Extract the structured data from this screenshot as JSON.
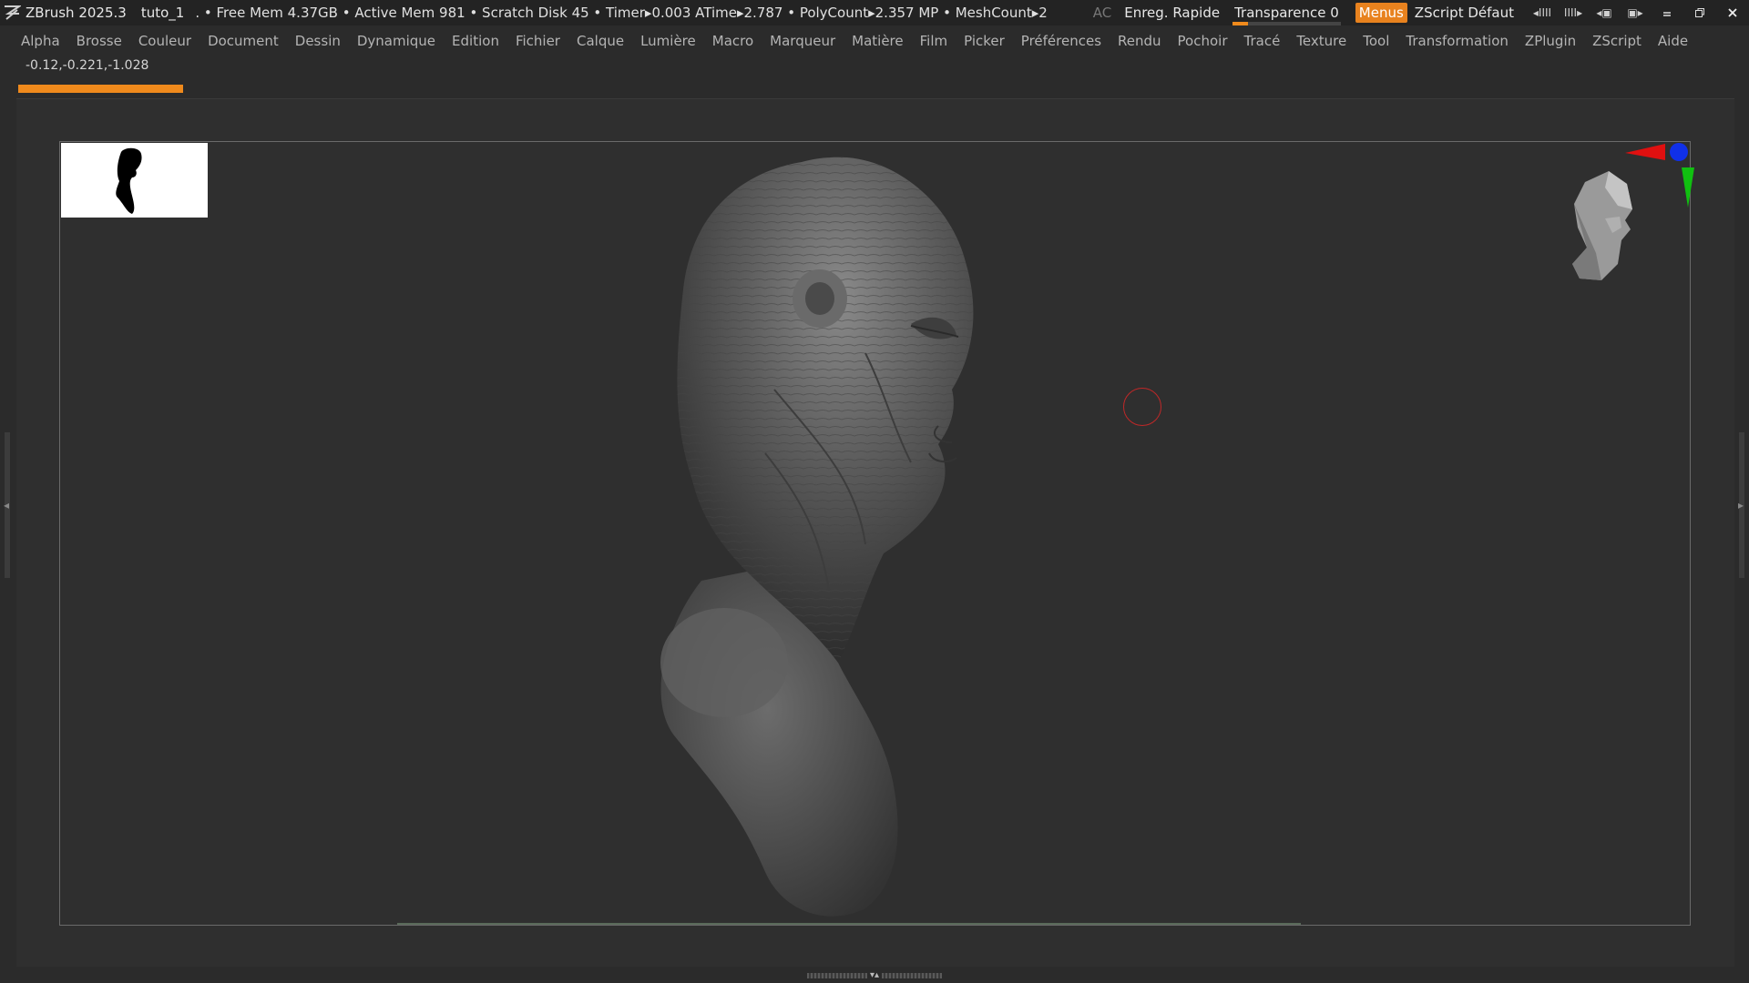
{
  "titlebar": {
    "app_title": "ZBrush 2025.3",
    "doc_name": "tuto_1",
    "stats": ". • Free Mem 4.37GB • Active Mem 981 • Scratch Disk 45 • Timer▸0.003 ATime▸2.787 • PolyCount▸2.357 MP • MeshCount▸2",
    "ac_label": "AC",
    "quicksave_label": "Enreg. Rapide",
    "transparency_label": "Transparence 0",
    "transparency_value": 0,
    "menus_button": "Menus",
    "zscript_default": "ZScript Défaut",
    "icons": [
      "palette-left-icon",
      "palette-right-icon",
      "layout-prev-icon",
      "layout-next-icon"
    ],
    "window_icons": [
      "minimize-icon",
      "restore-icon",
      "close-icon"
    ],
    "accent_color": "#e8821e"
  },
  "menubar": {
    "items": [
      "Alpha",
      "Brosse",
      "Couleur",
      "Document",
      "Dessin",
      "Dynamique",
      "Edition",
      "Fichier",
      "Calque",
      "Lumière",
      "Macro",
      "Marqueur",
      "Matière",
      "Film",
      "Picker",
      "Préférences",
      "Rendu",
      "Pochoir",
      "Tracé",
      "Texture",
      "Tool",
      "Transformation",
      "ZPlugin",
      "ZScript",
      "Aide"
    ]
  },
  "viewport": {
    "coordinate_readout": "-0.12,-0.221,-1.028",
    "progress_fraction": 1.0,
    "progress_color": "#f08a1c",
    "brush_cursor_color": "#c02828",
    "axis_colors": {
      "x": "#e01010",
      "y": "#10c010",
      "z": "#1020e0"
    }
  }
}
